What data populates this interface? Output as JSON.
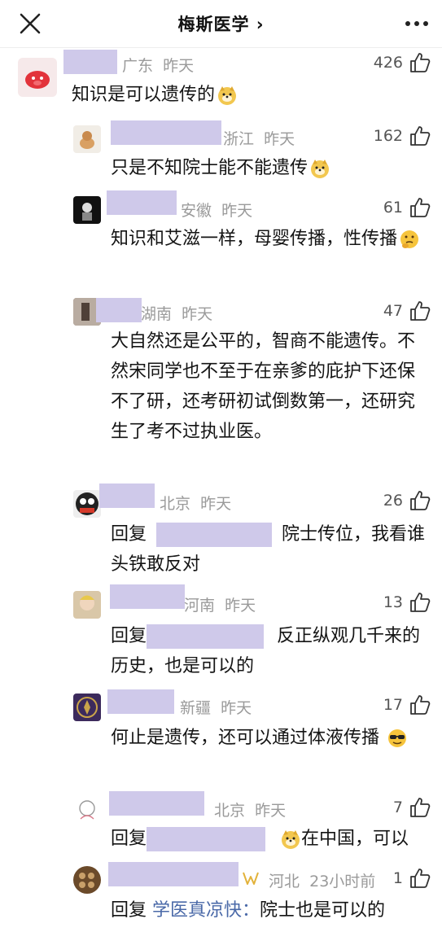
{
  "header": {
    "title": "梅斯医学 ›"
  },
  "comments": [
    {
      "location": "广东",
      "time": "昨天",
      "likes": "426",
      "text": "知识是可以遗传的"
    },
    {
      "location": "浙江",
      "time": "昨天",
      "likes": "162",
      "text": "只是不知院士能不能遗传"
    },
    {
      "location": "安徽",
      "time": "昨天",
      "likes": "61",
      "text": "知识和艾滋一样，母婴传播，性传播"
    },
    {
      "location": "湖南",
      "time": "昨天",
      "likes": "47",
      "text": "大自然还是公平的，智商不能遗传。不然宋同学也不至于在亲爹的庇护下还保不了研，还考研初试倒数第一，还研究生了考不过执业医。"
    },
    {
      "location": "北京",
      "time": "昨天",
      "likes": "26",
      "reply_prefix": "回复",
      "text": "院士传位，我看谁头铁敢反对"
    },
    {
      "location": "河南",
      "time": "昨天",
      "likes": "13",
      "reply_prefix": "回复",
      "text": "反正纵观几千来的历史，也是可以的"
    },
    {
      "location": "新疆",
      "time": "昨天",
      "likes": "17",
      "text": "何止是遗传，还可以通过体液传播"
    },
    {
      "location": "北京",
      "time": "昨天",
      "likes": "7",
      "reply_prefix": "回复",
      "text": "在中国，可以"
    },
    {
      "location": "河北",
      "time": "23小时前",
      "likes": "1",
      "reply_prefix": "回复",
      "reply_to": "学医真凉快：",
      "text": "院士也是可以的"
    }
  ]
}
